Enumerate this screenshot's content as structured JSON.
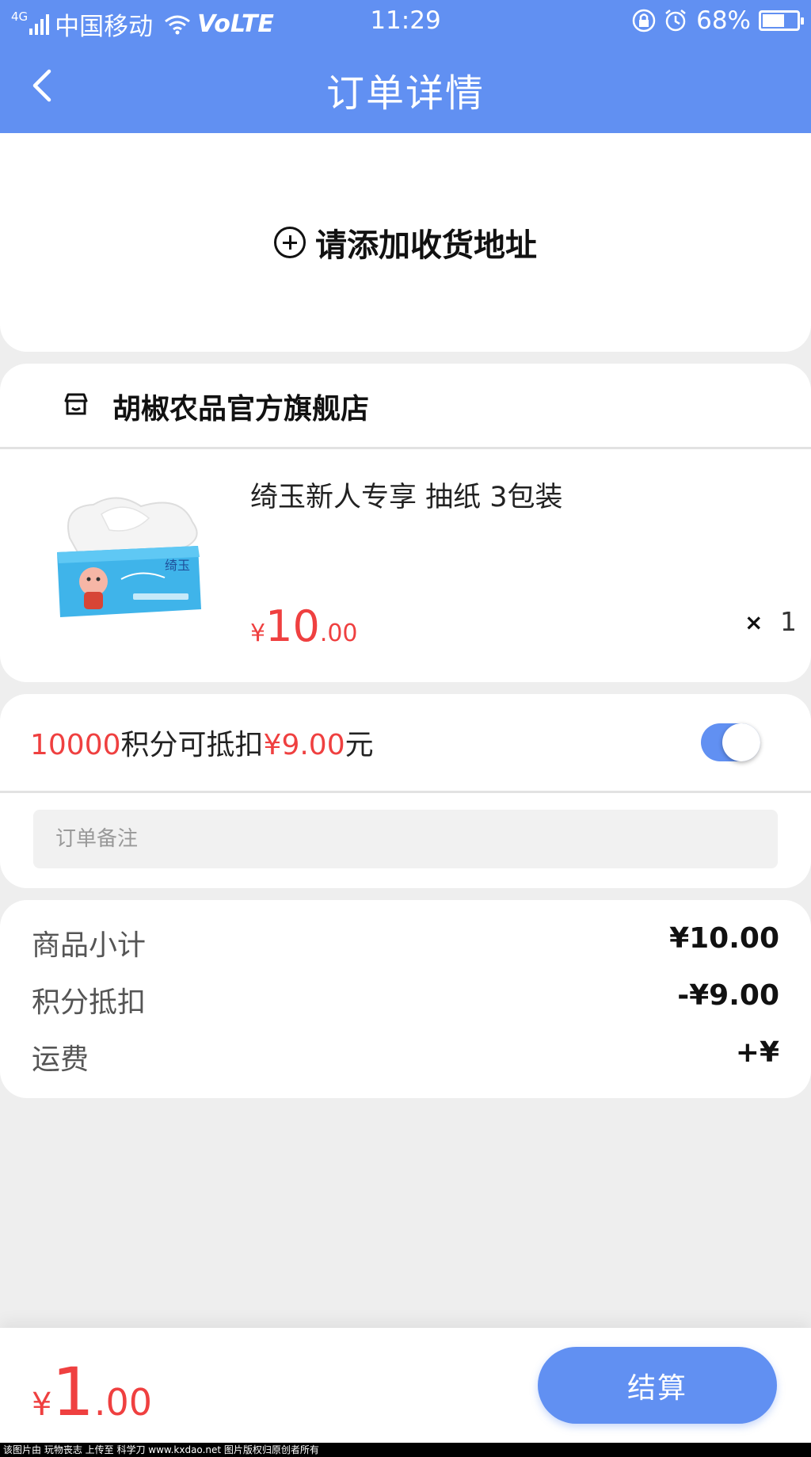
{
  "status_bar": {
    "network_tag": "4G",
    "carrier": "中国移动",
    "volte": "VoLTE",
    "time": "11:29",
    "battery": "68%",
    "battery_level": 0.68
  },
  "nav": {
    "title": "订单详情"
  },
  "address": {
    "add_label": "请添加收货地址"
  },
  "store": {
    "name": "胡椒农品官方旗舰店"
  },
  "product": {
    "name": "绮玉新人专享 抽纸 3包装",
    "currency": "¥",
    "price_int": "10",
    "price_dec": ".00",
    "times": "×",
    "quantity": "1"
  },
  "points": {
    "amount": "10000",
    "text_mid": "积分可抵扣",
    "deduct": "¥9.00",
    "unit": "元",
    "enabled": true
  },
  "remark": {
    "placeholder": "订单备注"
  },
  "summary": {
    "rows": [
      {
        "label": "商品小计",
        "value": "¥10.00"
      },
      {
        "label": "积分抵扣",
        "value": "-¥9.00"
      },
      {
        "label": "运费",
        "value": "+¥"
      }
    ]
  },
  "bottom": {
    "currency": "¥",
    "total_int": "1",
    "total_dec": ".00",
    "checkout_label": "结算"
  },
  "watermark": "该图片由 玩物丧志 上传至 科学刀 www.kxdao.net 图片版权归原创者所有",
  "colors": {
    "accent": "#6190f2",
    "price_red": "#ef4040",
    "background": "#eeeeee"
  }
}
